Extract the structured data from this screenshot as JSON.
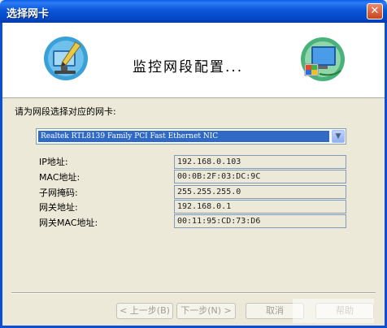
{
  "window": {
    "title": "选择网卡",
    "close_glyph": "✕"
  },
  "header": {
    "title": "监控网段配置..."
  },
  "prompt": "请为网段选择对应的网卡:",
  "nic_select": {
    "selected": "Realtek RTL8139 Family PCI Fast Ethernet NIC",
    "arrow": "▼"
  },
  "fields": [
    {
      "label": "IP地址:",
      "value": "192.168.0.103"
    },
    {
      "label": "MAC地址:",
      "value": "00:0B:2F:03:DC:9C"
    },
    {
      "label": "子网掩码:",
      "value": "255.255.255.0"
    },
    {
      "label": "网关地址:",
      "value": "192.168.0.1"
    },
    {
      "label": "网关MAC地址:",
      "value": "00:11:95:CD:73:D6"
    }
  ],
  "buttons": {
    "back": "< 上一步(B)",
    "next": "下一步(N) >",
    "cancel": "取消",
    "help": "帮助"
  },
  "colors": {
    "title_bar": "#0a56d8",
    "face": "#ece9d8",
    "selection": "#316ac5"
  }
}
